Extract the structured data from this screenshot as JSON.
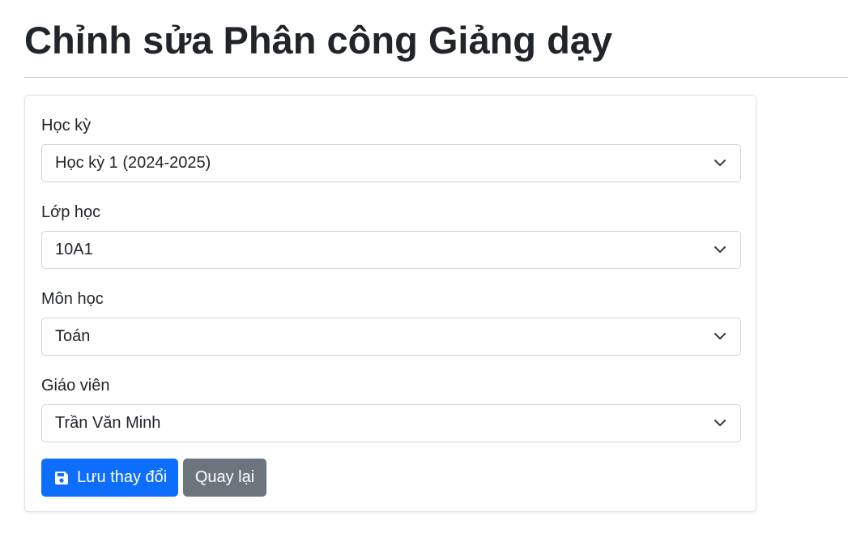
{
  "page": {
    "title": "Chỉnh sửa Phân công Giảng dạy"
  },
  "form": {
    "fields": [
      {
        "label": "Học kỳ",
        "value": "Học kỳ 1 (2024-2025)"
      },
      {
        "label": "Lớp học",
        "value": "10A1"
      },
      {
        "label": "Môn học",
        "value": "Toán"
      },
      {
        "label": "Giáo viên",
        "value": "Trần Văn Minh"
      }
    ],
    "save_label": "Lưu thay đổi",
    "back_label": "Quay lại"
  },
  "icons": {
    "select_caret": "chevron-down-icon",
    "save": "floppy-disk-icon"
  },
  "colors": {
    "primary": "#0d6efd",
    "secondary": "#6c757d",
    "text": "#212529",
    "border": "#ced4da"
  }
}
